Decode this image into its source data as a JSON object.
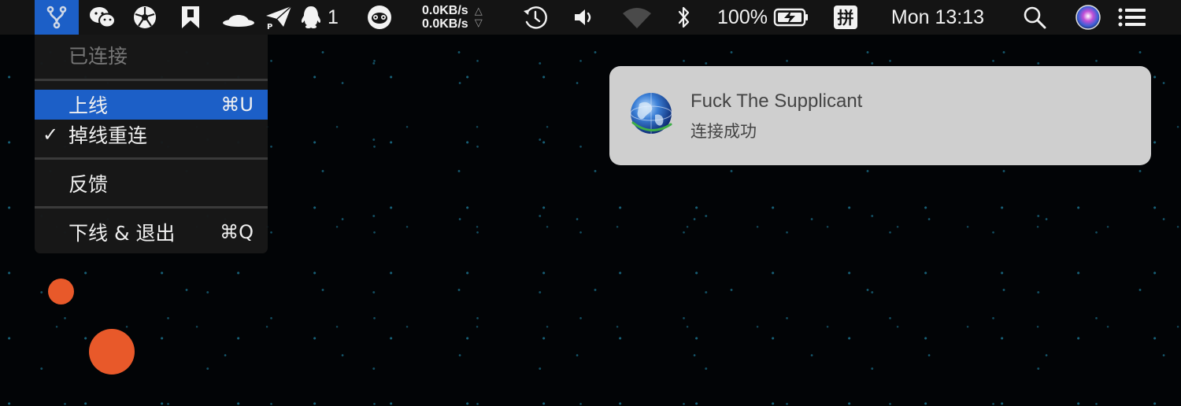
{
  "menubar": {
    "app_icon": "network-fork-icon",
    "items": [
      {
        "icon": "wechat-icon"
      },
      {
        "icon": "aperture-icon"
      },
      {
        "icon": "bookmark-app-icon"
      },
      {
        "icon": "helmet-icon"
      },
      {
        "icon": "paper-plane-icon"
      },
      {
        "icon": "qq-icon",
        "badge": "1"
      },
      {
        "icon": "owl-icon"
      }
    ],
    "net_upload": "0.0KB/s",
    "net_download": "0.0KB/s",
    "net_up_arrow": "△",
    "net_down_arrow": "▽",
    "time_machine_icon": "time-machine-icon",
    "volume_icon": "volume-icon",
    "wifi_icon": "wifi-icon",
    "bluetooth_icon": "bluetooth-icon",
    "battery_percent": "100%",
    "battery_icon": "battery-charging-icon",
    "input_method": "拼",
    "clock": "Mon 13:13",
    "search_icon": "spotlight-icon",
    "siri_icon": "siri-icon",
    "notification_center_icon": "list-icon"
  },
  "dropdown": {
    "status": "已连接",
    "items": [
      {
        "label": "上线",
        "shortcut": "⌘U",
        "highlighted": true
      },
      {
        "label": "掉线重连",
        "checked": true,
        "check_mark": "✓"
      },
      {
        "label": "反馈"
      },
      {
        "label": "下线 & 退出",
        "shortcut": "⌘Q"
      }
    ]
  },
  "notification": {
    "icon": "globe-icon",
    "title": "Fuck The Supplicant",
    "body": "连接成功"
  },
  "colors": {
    "accent": "#1c5fc7",
    "menubar": "#141414",
    "notification_bg": "#cfcfcf",
    "orange": "#e8592a"
  }
}
